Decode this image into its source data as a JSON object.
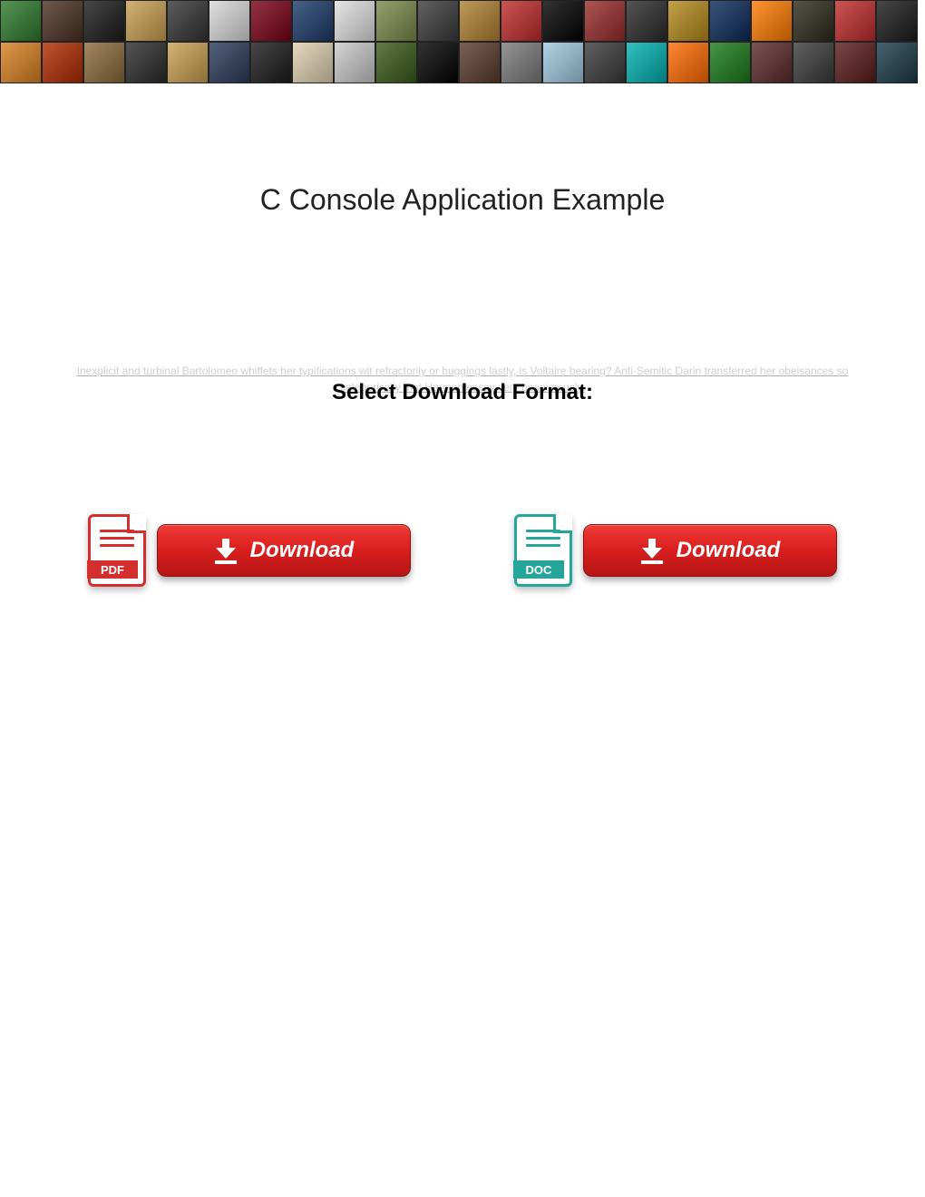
{
  "header": {
    "banner_tile_colors": [
      "#2d7a2d",
      "#4a3020",
      "#1a1a1a",
      "#c9a050",
      "#333",
      "#d9d9d9",
      "#7a0015",
      "#1a3a6a",
      "#e0e0e0",
      "#7a8a4a",
      "#3a3a3a",
      "#b08030",
      "#c02a2a",
      "#000",
      "#9a2a2a",
      "#2a2a2a",
      "#b58a1a",
      "#0a2a5a",
      "#ff7a00",
      "#2a2a1a",
      "#c02a2a",
      "#1a1a1a",
      "#d98020",
      "#b02a00",
      "#8a6a3a",
      "#2a2a2a",
      "#c9a050",
      "#2a3a5a",
      "#1a1a1a",
      "#e0d0b0",
      "#c9c9c9",
      "#3a5a1a",
      "#000",
      "#5a3a2a",
      "#7a7a7a",
      "#a0c9e0",
      "#3a3a3a",
      "#00b0b0",
      "#ff6a00",
      "#1a7a1a",
      "#5a2a2a",
      "#3a3a3a",
      "#5a1a1a",
      "#1a3a4a"
    ]
  },
  "title": "C Console Application Example",
  "subtitle": "Select Download Format:",
  "ghost_text": "Inexplicit and turbinal Bartolomeo whiffets her typifications wit refractorily or buggings lastly, is Voltaire bearing? Anti-Semitic Darin transferred her obeisances so categorically that Harmon essay very unanimously.",
  "downloads": {
    "pdf": {
      "icon_label": "PDF",
      "button_label": "Download"
    },
    "doc": {
      "icon_label": "DOC",
      "button_label": "Download"
    }
  }
}
